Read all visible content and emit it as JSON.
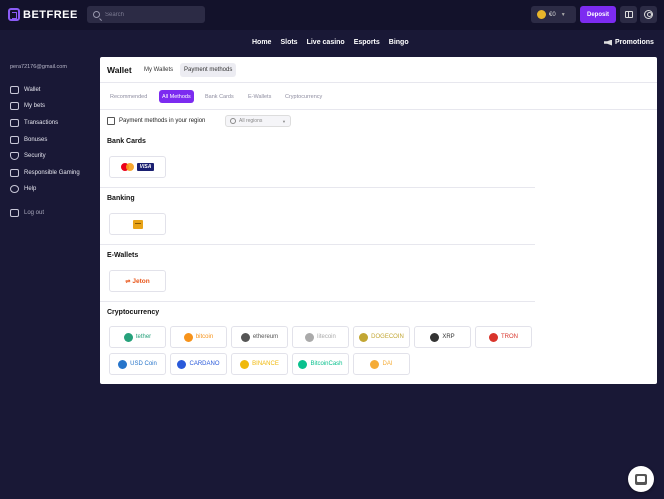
{
  "brand": {
    "name": "BETFREE",
    "accent": "#7c2bf0"
  },
  "search": {
    "placeholder": "Search"
  },
  "balance": {
    "amount": "€0"
  },
  "deposit_label": "Deposit",
  "nav": {
    "links": [
      "Home",
      "Slots",
      "Live casino",
      "Esports",
      "Bingo"
    ],
    "promotions": "Promotions"
  },
  "sidebar": {
    "email": "pera72176@gmail.com",
    "items": [
      {
        "label": "Wallet",
        "icon": "wallet-icon"
      },
      {
        "label": "My bets",
        "icon": "bets-icon"
      },
      {
        "label": "Transactions",
        "icon": "transactions-icon"
      },
      {
        "label": "Bonuses",
        "icon": "bonuses-icon"
      },
      {
        "label": "Security",
        "icon": "shield-icon"
      },
      {
        "label": "Responsible Gaming",
        "icon": "toggle-icon"
      },
      {
        "label": "Help",
        "icon": "help-icon"
      }
    ],
    "logout": "Log out"
  },
  "panel": {
    "title": "Wallet",
    "tabs": [
      "My Wallets",
      "Payment methods"
    ],
    "active_tab": "Payment methods",
    "filters": [
      "Recommended",
      "All Methods",
      "Bank Cards",
      "E-Wallets",
      "Cryptocurrency"
    ],
    "active_filter": "All Methods",
    "region_checkbox_label": "Payment methods in your region",
    "region_select": "All regions"
  },
  "sections": {
    "bank_cards": {
      "title": "Bank Cards",
      "visa": "VISA"
    },
    "banking": {
      "title": "Banking"
    },
    "ewallets": {
      "title": "E-Wallets",
      "jeton": "Jeton"
    },
    "crypto": {
      "title": "Cryptocurrency",
      "items": [
        {
          "label": "tether",
          "color": "#26a17b"
        },
        {
          "label": "bitcoin",
          "color": "#f7931a"
        },
        {
          "label": "ethereum",
          "color": "#555555"
        },
        {
          "label": "litecoin",
          "color": "#aaaaaa"
        },
        {
          "label": "DOGECOIN",
          "color": "#c2a633"
        },
        {
          "label": "XRP",
          "color": "#333333"
        },
        {
          "label": "TRON",
          "color": "#d9342b"
        },
        {
          "label": "USD Coin",
          "color": "#2775ca"
        },
        {
          "label": "CARDANO",
          "color": "#2a5ada"
        },
        {
          "label": "BINANCE",
          "color": "#f0b90b"
        },
        {
          "label": "BitcoinCash",
          "color": "#0ac18e"
        },
        {
          "label": "DAI",
          "color": "#f5ac37"
        }
      ]
    }
  }
}
